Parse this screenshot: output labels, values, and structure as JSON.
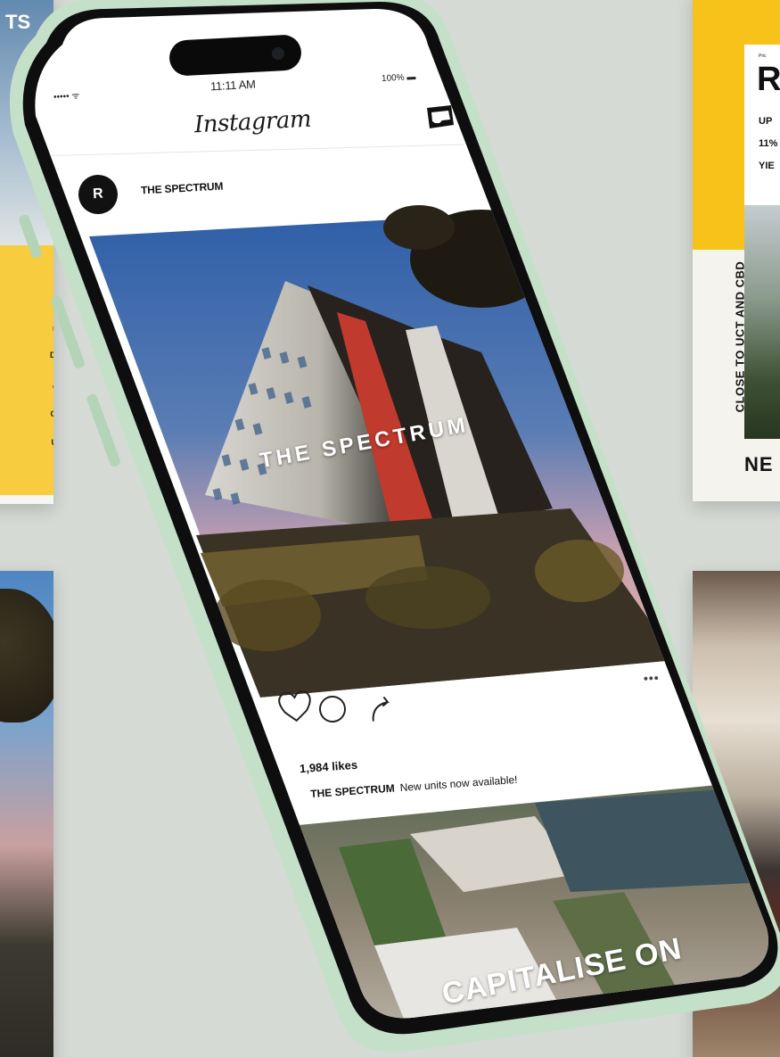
{
  "left_card_top": {
    "header": "TS",
    "tags": [
      "rum",
      "Duty",
      "ews",
      "CBD",
      "UCT"
    ]
  },
  "right_card_top": {
    "small_text": "Pric",
    "big_letter": "R",
    "lines": [
      "UP",
      "11%",
      "YIE"
    ],
    "vertical_text": "CLOSE TO UCT AND CBD",
    "bottom_text": "NE"
  },
  "phone": {
    "status_bar": {
      "signal": "••••• ᯤ",
      "time": "11:11 AM",
      "battery": "100% ▬"
    },
    "app_title": "Instagram",
    "post": {
      "account": "THE SPECTRUM",
      "avatar_letter": "R",
      "image_overlay": "THE SPECTRUM",
      "more": "•••",
      "likes": "1,984 likes",
      "caption_user": "THE SPECTRUM",
      "caption_text": "New units now available!"
    },
    "next_post_overlay": "CAPITALISE ON"
  },
  "colors": {
    "background": "#d6dad4",
    "phone_frame": "#c8e3cc",
    "accent_yellow": "#f7c31a"
  }
}
